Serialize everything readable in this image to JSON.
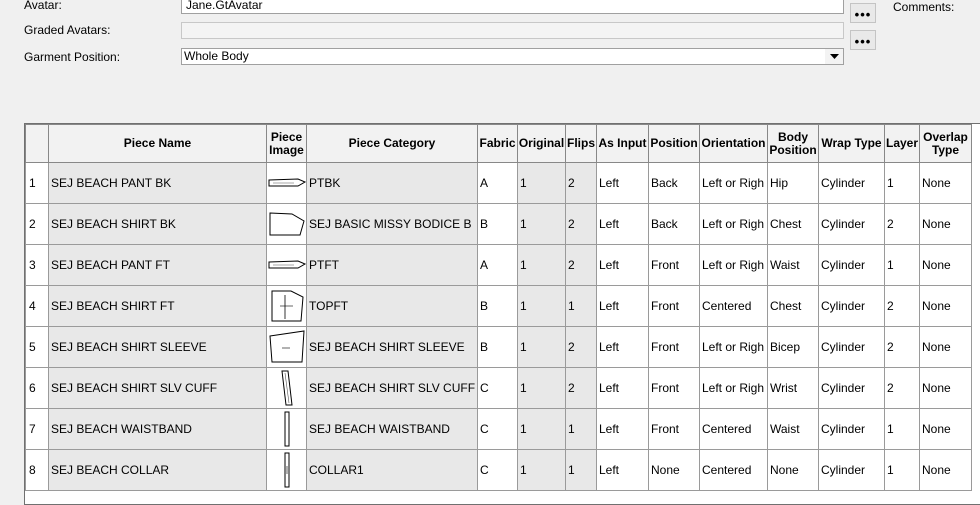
{
  "form": {
    "avatar_label": "Avatar:",
    "avatar_value": "Jane.GtAvatar",
    "graded_avatars_label": "Graded Avatars:",
    "graded_avatars_value": "",
    "garment_position_label": "Garment Position:",
    "garment_position_value": "Whole Body",
    "browse_label": "•••",
    "comments_label": "Comments:"
  },
  "table": {
    "columns": [
      "",
      "Piece Name",
      "Piece Image",
      "Piece Category",
      "Fabric",
      "Original",
      "Flips",
      "As Input",
      "Position",
      "Orientation",
      "Body Position",
      "Wrap Type",
      "Layer",
      "Overlap Type"
    ],
    "rows": [
      {
        "n": "1",
        "name": "SEJ BEACH PANT BK",
        "icon": "pant-piece-icon",
        "category": "PTBK",
        "fabric": "A",
        "original": "1",
        "flips": "2",
        "as_input": "Left",
        "position": "Back",
        "orientation": "Left or Righ",
        "body_position": "Hip",
        "wrap_type": "Cylinder",
        "layer": "1",
        "overlap": "None"
      },
      {
        "n": "2",
        "name": "SEJ BEACH SHIRT BK",
        "icon": "bodice-piece-icon",
        "category": "SEJ BASIC MISSY BODICE B",
        "fabric": "B",
        "original": "1",
        "flips": "2",
        "as_input": "Left",
        "position": "Back",
        "orientation": "Left or Righ",
        "body_position": "Chest",
        "wrap_type": "Cylinder",
        "layer": "2",
        "overlap": "None"
      },
      {
        "n": "3",
        "name": "SEJ BEACH PANT FT",
        "icon": "pant-piece-icon",
        "category": "PTFT",
        "fabric": "A",
        "original": "1",
        "flips": "2",
        "as_input": "Left",
        "position": "Front",
        "orientation": "Left or Righ",
        "body_position": "Waist",
        "wrap_type": "Cylinder",
        "layer": "1",
        "overlap": "None"
      },
      {
        "n": "4",
        "name": "SEJ BEACH SHIRT FT",
        "icon": "shirt-front-piece-icon",
        "category": "TOPFT",
        "fabric": "B",
        "original": "1",
        "flips": "1",
        "as_input": "Left",
        "position": "Front",
        "orientation": "Centered",
        "body_position": "Chest",
        "wrap_type": "Cylinder",
        "layer": "2",
        "overlap": "None"
      },
      {
        "n": "5",
        "name": "SEJ BEACH SHIRT SLEEVE",
        "icon": "sleeve-piece-icon",
        "category": "SEJ BEACH SHIRT SLEEVE",
        "fabric": "B",
        "original": "1",
        "flips": "2",
        "as_input": "Left",
        "position": "Front",
        "orientation": "Left or Righ",
        "body_position": "Bicep",
        "wrap_type": "Cylinder",
        "layer": "2",
        "overlap": "None"
      },
      {
        "n": "6",
        "name": "SEJ BEACH SHIRT SLV CUFF",
        "icon": "cuff-piece-icon",
        "category": "SEJ BEACH SHIRT SLV CUFF",
        "fabric": "C",
        "original": "1",
        "flips": "2",
        "as_input": "Left",
        "position": "Front",
        "orientation": "Left or Righ",
        "body_position": "Wrist",
        "wrap_type": "Cylinder",
        "layer": "2",
        "overlap": "None"
      },
      {
        "n": "7",
        "name": "SEJ BEACH WAISTBAND",
        "icon": "waistband-piece-icon",
        "category": "SEJ BEACH WAISTBAND",
        "fabric": "C",
        "original": "1",
        "flips": "1",
        "as_input": "Left",
        "position": "Front",
        "orientation": "Centered",
        "body_position": "Waist",
        "wrap_type": "Cylinder",
        "layer": "1",
        "overlap": "None"
      },
      {
        "n": "8",
        "name": "SEJ BEACH COLLAR",
        "icon": "collar-piece-icon",
        "category": "COLLAR1",
        "fabric": "C",
        "original": "1",
        "flips": "1",
        "as_input": "Left",
        "position": "None",
        "orientation": "Centered",
        "body_position": "None",
        "wrap_type": "Cylinder",
        "layer": "1",
        "overlap": "None"
      }
    ]
  }
}
